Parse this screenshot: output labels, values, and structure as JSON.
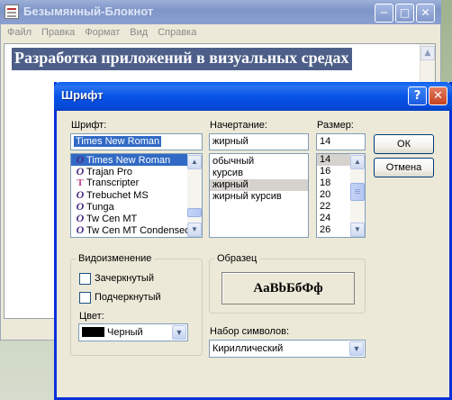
{
  "notepad": {
    "title": "Безымянный-Блокнот",
    "menu": [
      "Файл",
      "Правка",
      "Формат",
      "Вид",
      "Справка"
    ],
    "text": "Разработка приложений в визуальных средах",
    "minimize": "─",
    "maximize": "□",
    "close": "✕"
  },
  "dialog": {
    "title": "Шрифт",
    "help": "?",
    "close": "✕",
    "font_label": "Шрифт:",
    "font_value": "Times New Roman",
    "fonts": [
      {
        "icon": "O",
        "name": "Times New Roman"
      },
      {
        "icon": "O",
        "name": "Trajan Pro"
      },
      {
        "icon": "T",
        "name": "Transcripter"
      },
      {
        "icon": "O",
        "name": "Trebuchet MS"
      },
      {
        "icon": "O",
        "name": "Tunga"
      },
      {
        "icon": "O",
        "name": "Tw Cen MT"
      },
      {
        "icon": "O",
        "name": "Tw Cen MT Condensed"
      }
    ],
    "style_label": "Начертание:",
    "style_value": "жирный",
    "styles": [
      "обычный",
      "курсив",
      "жирный",
      "жирный курсив"
    ],
    "size_label": "Размер:",
    "size_value": "14",
    "sizes": [
      "14",
      "16",
      "18",
      "20",
      "22",
      "24",
      "26"
    ],
    "ok": "ОК",
    "cancel": "Отмена",
    "effects_label": "Видоизменение",
    "strikeout": "Зачеркнутый",
    "underline": "Подчеркнутый",
    "color_label": "Цвет:",
    "color_value": "Черный",
    "sample_label": "Образец",
    "sample_text": "AaBbБбФф",
    "charset_label": "Набор символов:",
    "charset_value": "Кириллический"
  }
}
